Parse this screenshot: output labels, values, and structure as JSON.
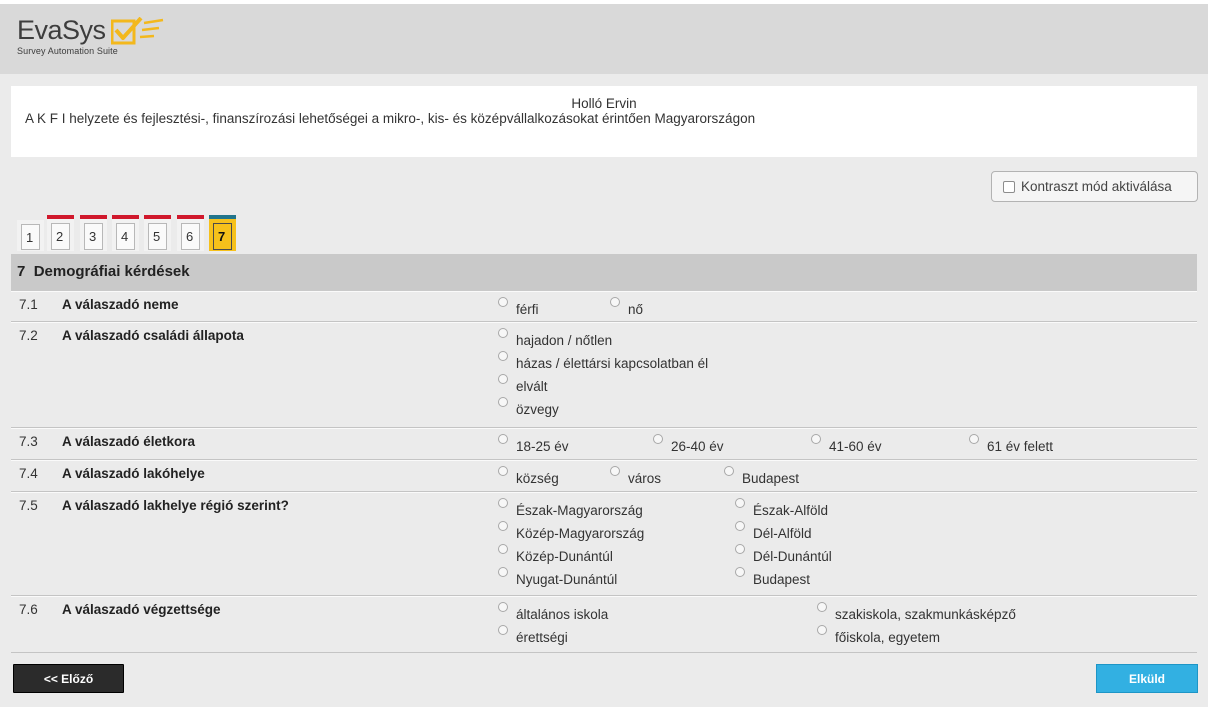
{
  "brand": {
    "word": "EvaSys",
    "subtitle": "Survey Automation Suite",
    "accent": "#f3b81c"
  },
  "survey": {
    "person": "Holló Ervin",
    "title": "A K F I helyzete és fejlesztési-, finanszírozási lehetőségei a mikro-, kis- és középvállalkozásokat érintően Magyarországon"
  },
  "contrast": {
    "label": "Kontraszt mód aktiválása",
    "checked": false
  },
  "tabs": [
    {
      "label": "1"
    },
    {
      "label": "2"
    },
    {
      "label": "3"
    },
    {
      "label": "4"
    },
    {
      "label": "5"
    },
    {
      "label": "6"
    },
    {
      "label": "7",
      "active": true
    }
  ],
  "section": {
    "number": "7",
    "title": "Demográfiai kérdések"
  },
  "questions": [
    {
      "num": "7.1",
      "text": "A válaszadó neme",
      "options": [
        "férfi",
        "nő"
      ]
    },
    {
      "num": "7.2",
      "text": "A válaszadó családi állapota",
      "options": [
        "hajadon / nőtlen",
        "házas / élettársi kapcsolatban él",
        "elvált",
        "özvegy"
      ]
    },
    {
      "num": "7.3",
      "text": "A válaszadó életkora",
      "options": [
        "18-25 év",
        "26-40 év",
        "41-60 év",
        "61 év felett"
      ]
    },
    {
      "num": "7.4",
      "text": "A válaszadó lakóhelye",
      "options": [
        "község",
        "város",
        "Budapest"
      ]
    },
    {
      "num": "7.5",
      "text": "A válaszadó lakhelye régió szerint?",
      "options": [
        "Észak-Magyarország",
        "Észak-Alföld",
        "Közép-Magyarország",
        "Dél-Alföld",
        "Közép-Dunántúl",
        "Dél-Dunántúl",
        "Nyugat-Dunántúl",
        "Budapest"
      ]
    },
    {
      "num": "7.6",
      "text": "A válaszadó végzettsége",
      "options": [
        "általános iskola",
        "szakiskola, szakmunkásképző",
        "érettségi",
        "főiskola, egyetem"
      ]
    }
  ],
  "nav": {
    "prev_label": "<< Előző",
    "submit_label": "Elküld"
  },
  "colors": {
    "tab_done": "#d0182c",
    "tab_active_top": "#22758c",
    "tab_active_bg": "#f6c11b",
    "submit": "#32b0e2"
  }
}
